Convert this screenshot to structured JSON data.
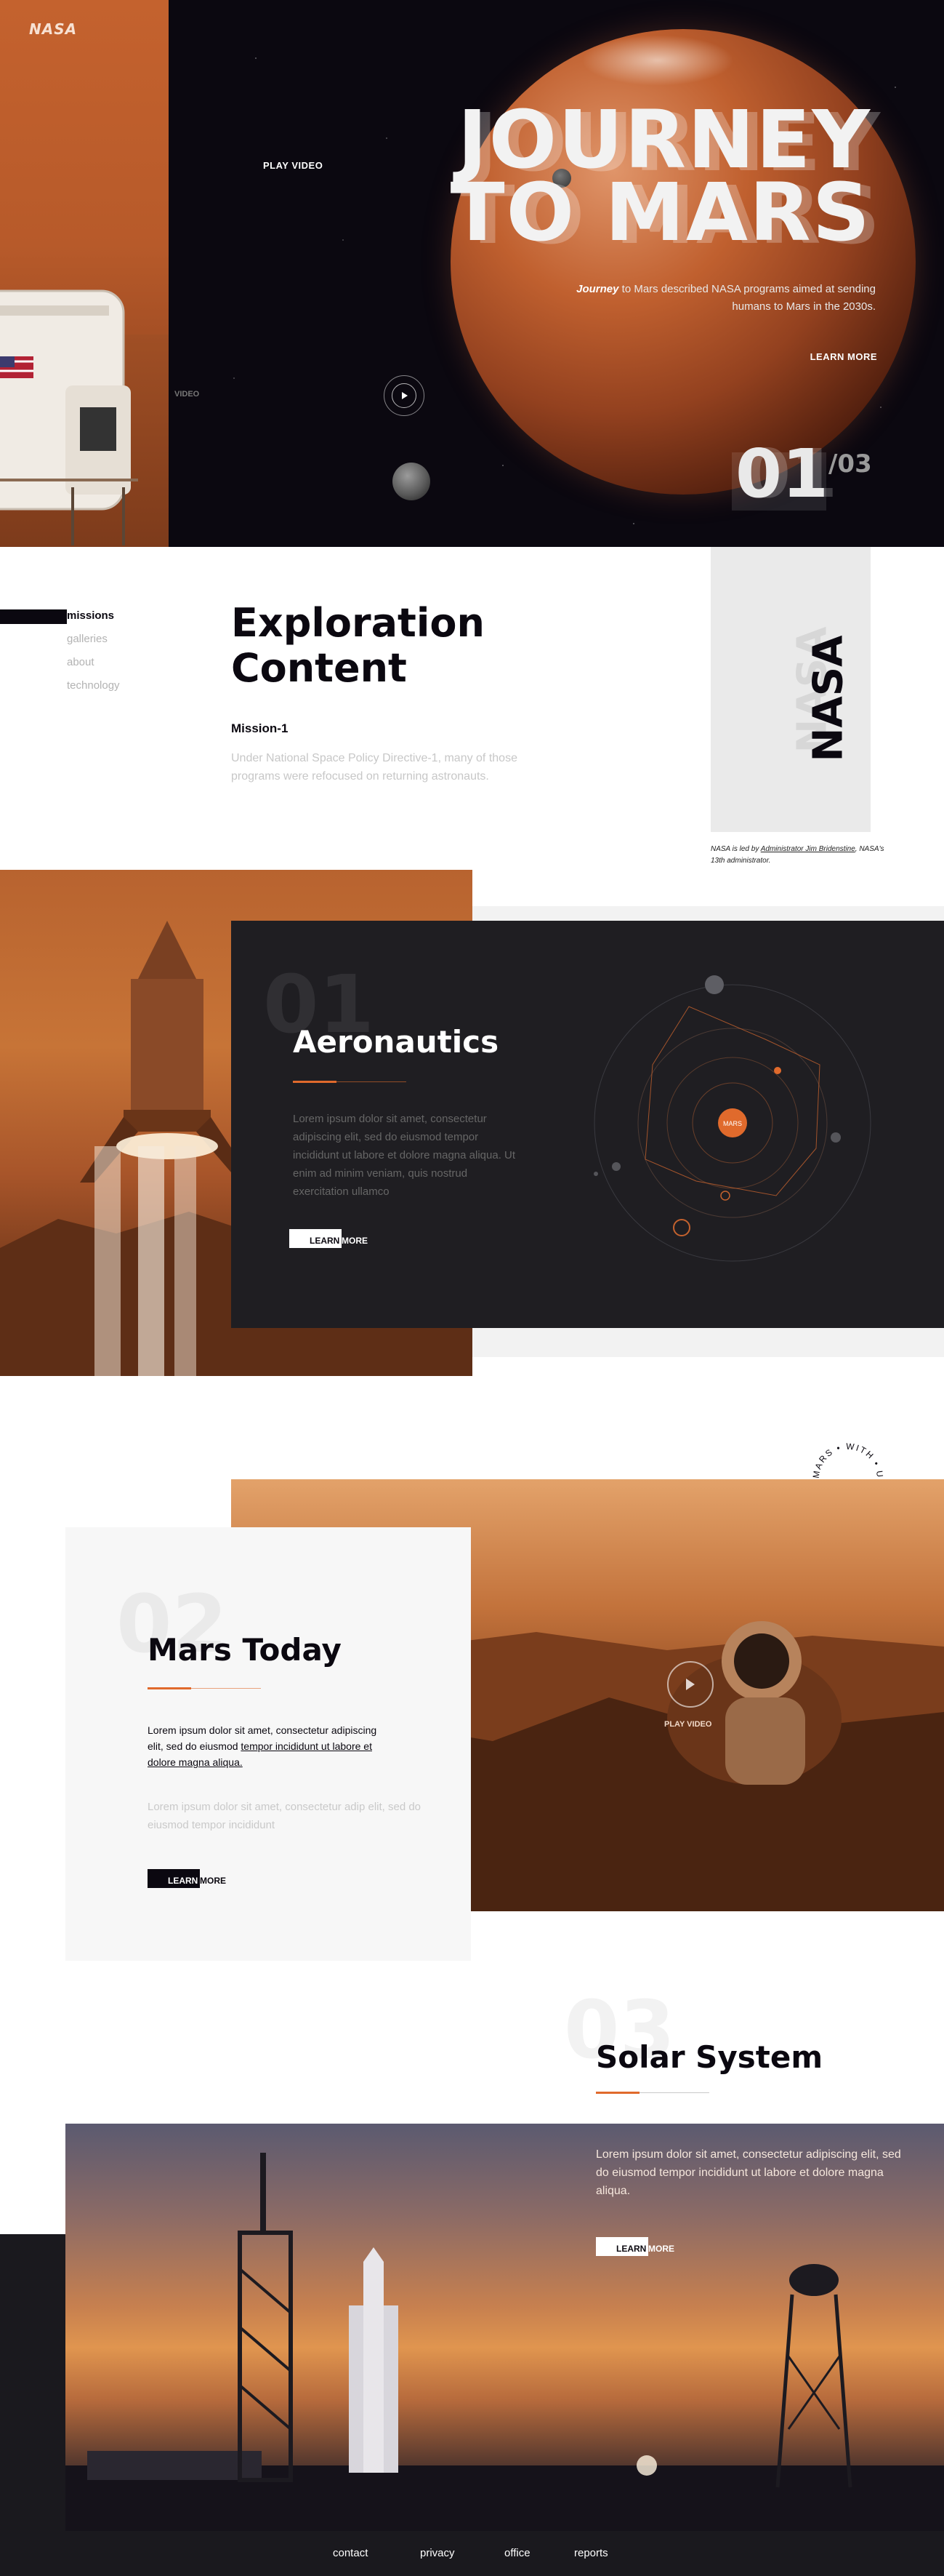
{
  "header": {
    "logo": "NASA"
  },
  "hero": {
    "play_video": "PLAY VIDEO",
    "video_side": "VIDEO",
    "title_line1": "JOURNEY",
    "title_line2": "TO MARS",
    "desc_em": "Journey",
    "desc_rest": " to Mars described NASA programs aimed at sending humans to Mars in the 2030s.",
    "learn_more": "LEARN MORE",
    "slide_current": "01",
    "slide_total": "/03"
  },
  "side_nav": {
    "items": [
      "missions",
      "galleries",
      "about",
      "technology"
    ],
    "active": "missions"
  },
  "exploration": {
    "title_line1": "Exploration",
    "title_line2": "Content",
    "mission_label": "Mission-1",
    "mission_text": "Under National Space Policy Directive-1, many of those programs were refocused on returning astronauts.",
    "nasa_vertical": "NASA",
    "caption_pre": "NASA is led by ",
    "caption_link": "Administrator Jim Bridenstine",
    "caption_post": ", NASA's 13th administrator."
  },
  "aeronautics": {
    "number": "01",
    "title": "Aeronautics",
    "text": "Lorem ipsum dolor sit amet, consectetur adipiscing elit, sed do eiusmod tempor incididunt ut labore et dolore magna aliqua. Ut enim ad minim veniam, quis nostrud exercitation ullamco",
    "learn": "LEARN",
    "more": "MORE"
  },
  "mars_today": {
    "stamp_text": "MARS • WITH • US EXPLORE •",
    "number": "02",
    "title": "Mars Today",
    "text_dark_pre": "Lorem ipsum dolor sit amet, consectetur adipiscing elit, sed do eiusmod ",
    "text_dark_link": "tempor incididunt ut labore et dolore magna aliqua.",
    "text_light": "Lorem ipsum dolor sit amet, consectetur adip elit, sed do eiusmod tempor incididunt",
    "play_video": "PLAY VIDEO",
    "learn": "LEARN",
    "more": "MORE"
  },
  "solar": {
    "number": "03",
    "title": "Solar System",
    "text": "Lorem ipsum dolor sit amet, consectetur adipiscing elit, sed do eiusmod tempor incididunt ut labore et dolore magna aliqua.",
    "learn": "LEARN",
    "more": "MORE"
  },
  "footer": {
    "links": [
      "contact",
      "privacy",
      "office",
      "reports"
    ]
  },
  "colors": {
    "accent": "#e06a2c",
    "dark": "#0b0810",
    "card_dark": "#1f1e22"
  }
}
